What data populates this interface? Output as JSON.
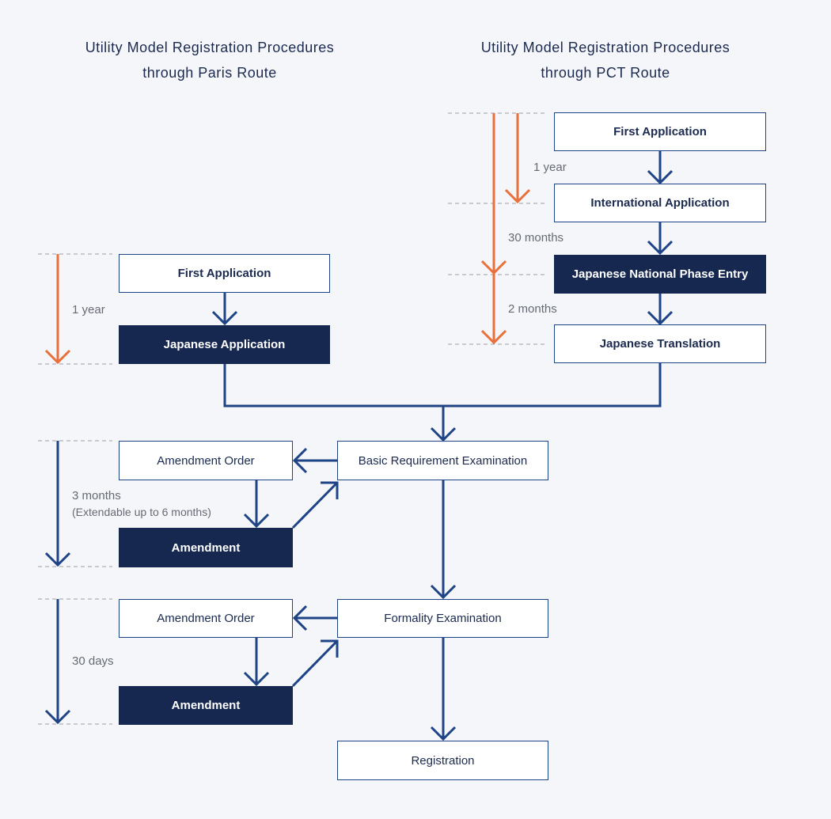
{
  "titles": {
    "left": [
      "Utility Model Registration Procedures",
      "through Paris Route"
    ],
    "right": [
      "Utility Model Registration Procedures",
      "through PCT Route"
    ]
  },
  "colors": {
    "navy": "#16284f",
    "flow_blue": "#1f4387",
    "orange": "#e8703a",
    "dash_gray": "#9a9ea6",
    "background": "#f5f6fa"
  },
  "paris_route": {
    "first_application": "First Application",
    "japanese_application": "Japanese Application",
    "deadline_label": "1 year"
  },
  "pct_route": {
    "first_application": "First Application",
    "international_application": "International Application",
    "national_phase_entry": "Japanese National Phase Entry",
    "japanese_translation": "Japanese Translation",
    "deadline_1": "1 year",
    "deadline_2": "30 months",
    "deadline_3": "2 months"
  },
  "examination": {
    "basic_requirement": "Basic Requirement Examination",
    "amendment_order_1": "Amendment Order",
    "amendment_1": "Amendment",
    "deadline_1": "3 months",
    "deadline_1_note": "(Extendable up to 6 months)",
    "formality": "Formality Examination",
    "amendment_order_2": "Amendment Order",
    "amendment_2": "Amendment",
    "deadline_2": "30 days",
    "registration": "Registration"
  }
}
